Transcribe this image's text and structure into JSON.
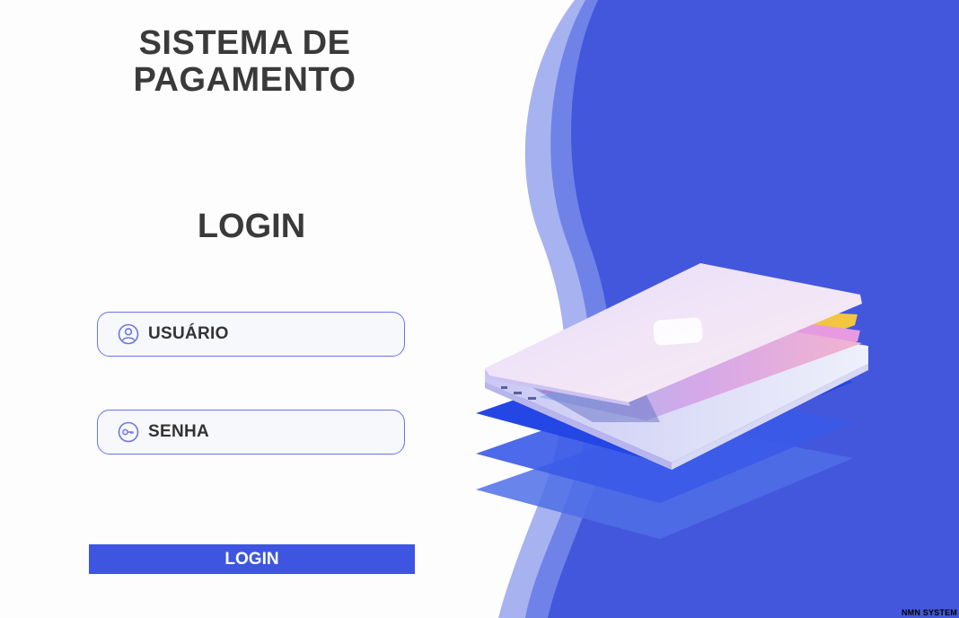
{
  "header": {
    "title_line1": "SISTEMA DE",
    "title_line2": "PAGAMENTO"
  },
  "login_form": {
    "heading": "LOGIN",
    "username": {
      "label": "USUÁRIO",
      "icon": "user-icon"
    },
    "password": {
      "label": "SENHA",
      "icon": "key-icon"
    },
    "submit_label": "LOGIN"
  },
  "footer": {
    "brand": "NMN SYSTEM"
  },
  "colors": {
    "primary": "#3d55e0",
    "panel_blue": "#4357dd",
    "wave_light": "#a7b2f1",
    "field_border": "#6b74e6",
    "title_text": "#3a3a3a"
  },
  "illustration": {
    "icon": "laptop-illustration"
  }
}
